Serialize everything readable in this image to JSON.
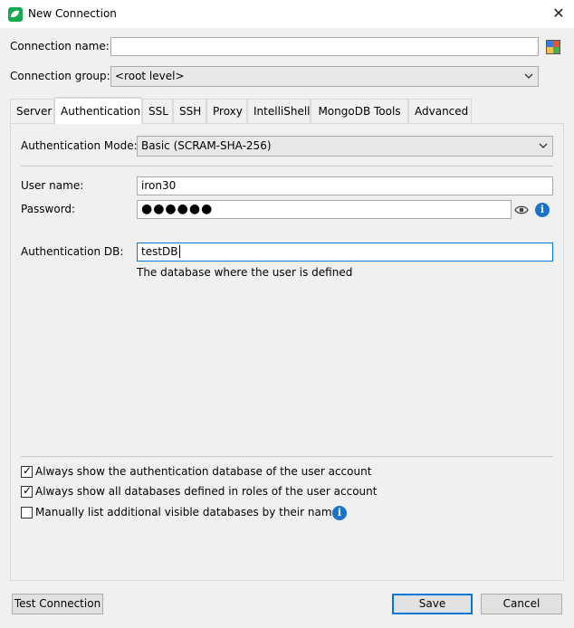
{
  "window": {
    "title": "New Connection",
    "close_glyph": "✕"
  },
  "fields": {
    "connection_name_label": "Connection name:",
    "connection_name_value": "",
    "connection_group_label": "Connection group:",
    "connection_group_value": "<root level>"
  },
  "tabs": [
    {
      "label": "Server"
    },
    {
      "label": "Authentication",
      "active": true
    },
    {
      "label": "SSL"
    },
    {
      "label": "SSH"
    },
    {
      "label": "Proxy"
    },
    {
      "label": "IntelliShell"
    },
    {
      "label": "MongoDB Tools"
    },
    {
      "label": "Advanced"
    }
  ],
  "auth": {
    "mode_label": "Authentication Mode:",
    "mode_value": "Basic (SCRAM-SHA-256)",
    "username_label": "User name:",
    "username_value": "iron30",
    "password_label": "Password:",
    "password_mask": "●●●●●●",
    "authdb_label": "Authentication DB:",
    "authdb_value": "testDB",
    "authdb_hint": "The database where the user is defined"
  },
  "options": [
    {
      "label": "Always show the authentication database of the user account",
      "checked": true
    },
    {
      "label": "Always show all databases defined in roles of the user account",
      "checked": true
    },
    {
      "label": "Manually list additional visible databases by their names",
      "checked": false
    }
  ],
  "buttons": {
    "test_connection": "Test Connection",
    "save": "Save",
    "cancel": "Cancel"
  },
  "icons": {
    "app": "mongodb-leaf-icon",
    "color_picker": "color-picker-icon",
    "eye": "eye-icon",
    "info": "info-icon"
  },
  "colors": {
    "accent": "#0078d7",
    "info": "#1a73c9",
    "app": "#13aa52"
  }
}
